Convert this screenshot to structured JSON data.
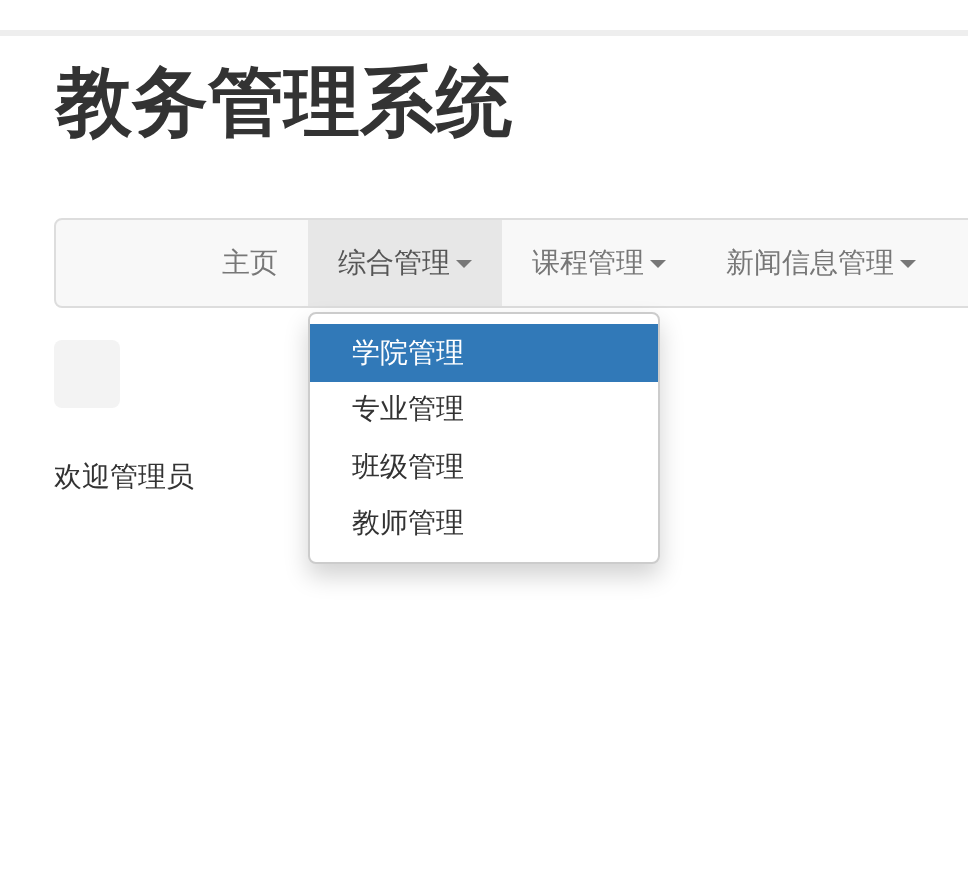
{
  "title": "教务管理系统",
  "nav": [
    {
      "label": "主页",
      "dropdown": false,
      "selected": false
    },
    {
      "label": "综合管理",
      "dropdown": true,
      "selected": true
    },
    {
      "label": "课程管理",
      "dropdown": true,
      "selected": false
    },
    {
      "label": "新闻信息管理",
      "dropdown": true,
      "selected": false
    }
  ],
  "menu": [
    {
      "label": "学院管理",
      "selected": true
    },
    {
      "label": "专业管理",
      "selected": false
    },
    {
      "label": "班级管理",
      "selected": false
    },
    {
      "label": "教师管理",
      "selected": false
    }
  ],
  "welcome": "欢迎管理员"
}
